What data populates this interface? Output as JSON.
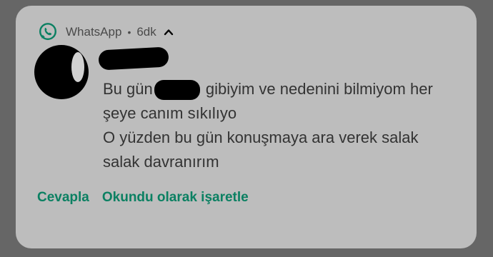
{
  "notification": {
    "app_name": "WhatsApp",
    "separator": "•",
    "time": "6dk",
    "sender_name": "",
    "message": {
      "line1_prefix": "Bu gün",
      "line1_suffix": "gibiyim ve nedenini bilmiyom her",
      "line2": "şeye canım sıkılıyo",
      "line3": "O yüzden bu gün konuşmaya ara verek salak",
      "line4": "salak davranırım"
    },
    "actions": {
      "reply": "Cevapla",
      "mark_read": "Okundu olarak işaretle"
    }
  },
  "colors": {
    "background": "#666666",
    "card": "#bdbdbd",
    "accent": "#0b8062",
    "header_text": "#4a4a4a",
    "message_text": "#333333"
  },
  "icons": {
    "app": "whatsapp-icon",
    "expand": "chevron-up-icon"
  }
}
